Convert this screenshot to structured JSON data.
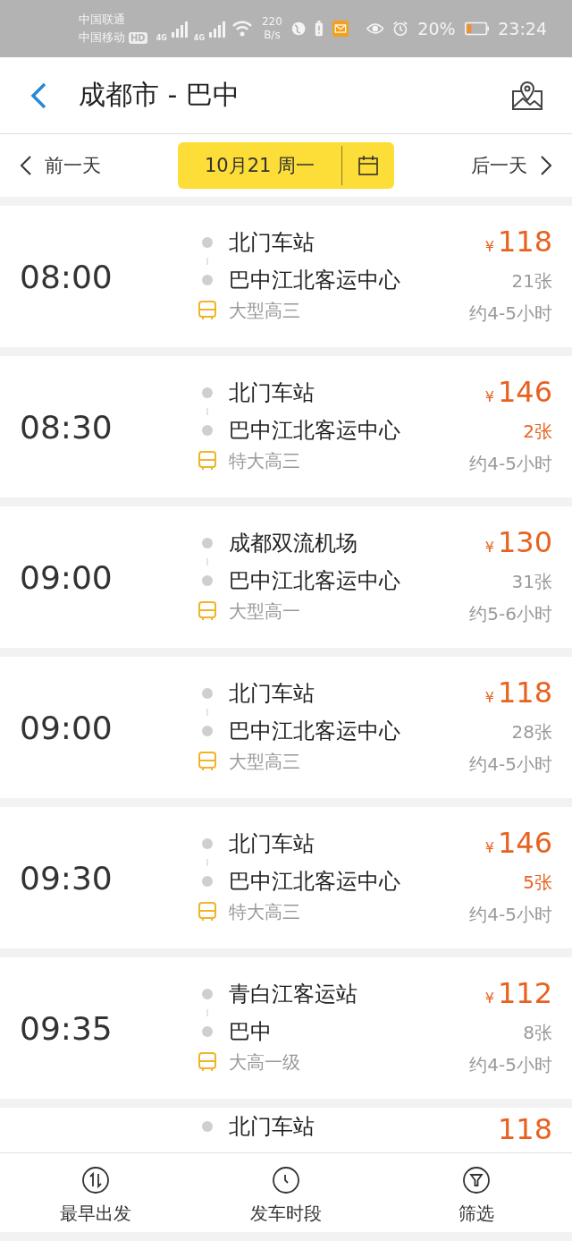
{
  "status_bar": {
    "carrier_1": "中国联通",
    "carrier_2": "中国移动",
    "hd_badge": "HD",
    "network_1": "4G",
    "network_2": "4G",
    "speed_value": "220",
    "speed_unit": "B/s",
    "battery": "20%",
    "time": "23:24"
  },
  "header": {
    "title": "成都市 - 巴中"
  },
  "date_bar": {
    "prev": "前一天",
    "date": "10月21 周一",
    "next": "后一天"
  },
  "trips": [
    {
      "time": "08:00",
      "from": "北门车站",
      "to": "巴中江北客运中心",
      "bus_type": "大型高三",
      "currency": "¥",
      "price": "118",
      "tickets": "21张",
      "tickets_low": false,
      "duration": "约4-5小时"
    },
    {
      "time": "08:30",
      "from": "北门车站",
      "to": "巴中江北客运中心",
      "bus_type": "特大高三",
      "currency": "¥",
      "price": "146",
      "tickets": "2张",
      "tickets_low": true,
      "duration": "约4-5小时"
    },
    {
      "time": "09:00",
      "from": "成都双流机场",
      "to": "巴中江北客运中心",
      "bus_type": "大型高一",
      "currency": "¥",
      "price": "130",
      "tickets": "31张",
      "tickets_low": false,
      "duration": "约5-6小时"
    },
    {
      "time": "09:00",
      "from": "北门车站",
      "to": "巴中江北客运中心",
      "bus_type": "大型高三",
      "currency": "¥",
      "price": "118",
      "tickets": "28张",
      "tickets_low": false,
      "duration": "约4-5小时"
    },
    {
      "time": "09:30",
      "from": "北门车站",
      "to": "巴中江北客运中心",
      "bus_type": "特大高三",
      "currency": "¥",
      "price": "146",
      "tickets": "5张",
      "tickets_low": true,
      "duration": "约4-5小时"
    },
    {
      "time": "09:35",
      "from": "青白江客运站",
      "to": "巴中",
      "bus_type": "大高一级",
      "currency": "¥",
      "price": "112",
      "tickets": "8张",
      "tickets_low": false,
      "duration": "约4-5小时"
    }
  ],
  "partial_trip": {
    "from": "北门车站",
    "price": "118"
  },
  "bottom_bar": [
    {
      "kind": "sort",
      "label": "最早出发"
    },
    {
      "kind": "clock",
      "label": "发车时段"
    },
    {
      "kind": "filter",
      "label": "筛选"
    }
  ]
}
